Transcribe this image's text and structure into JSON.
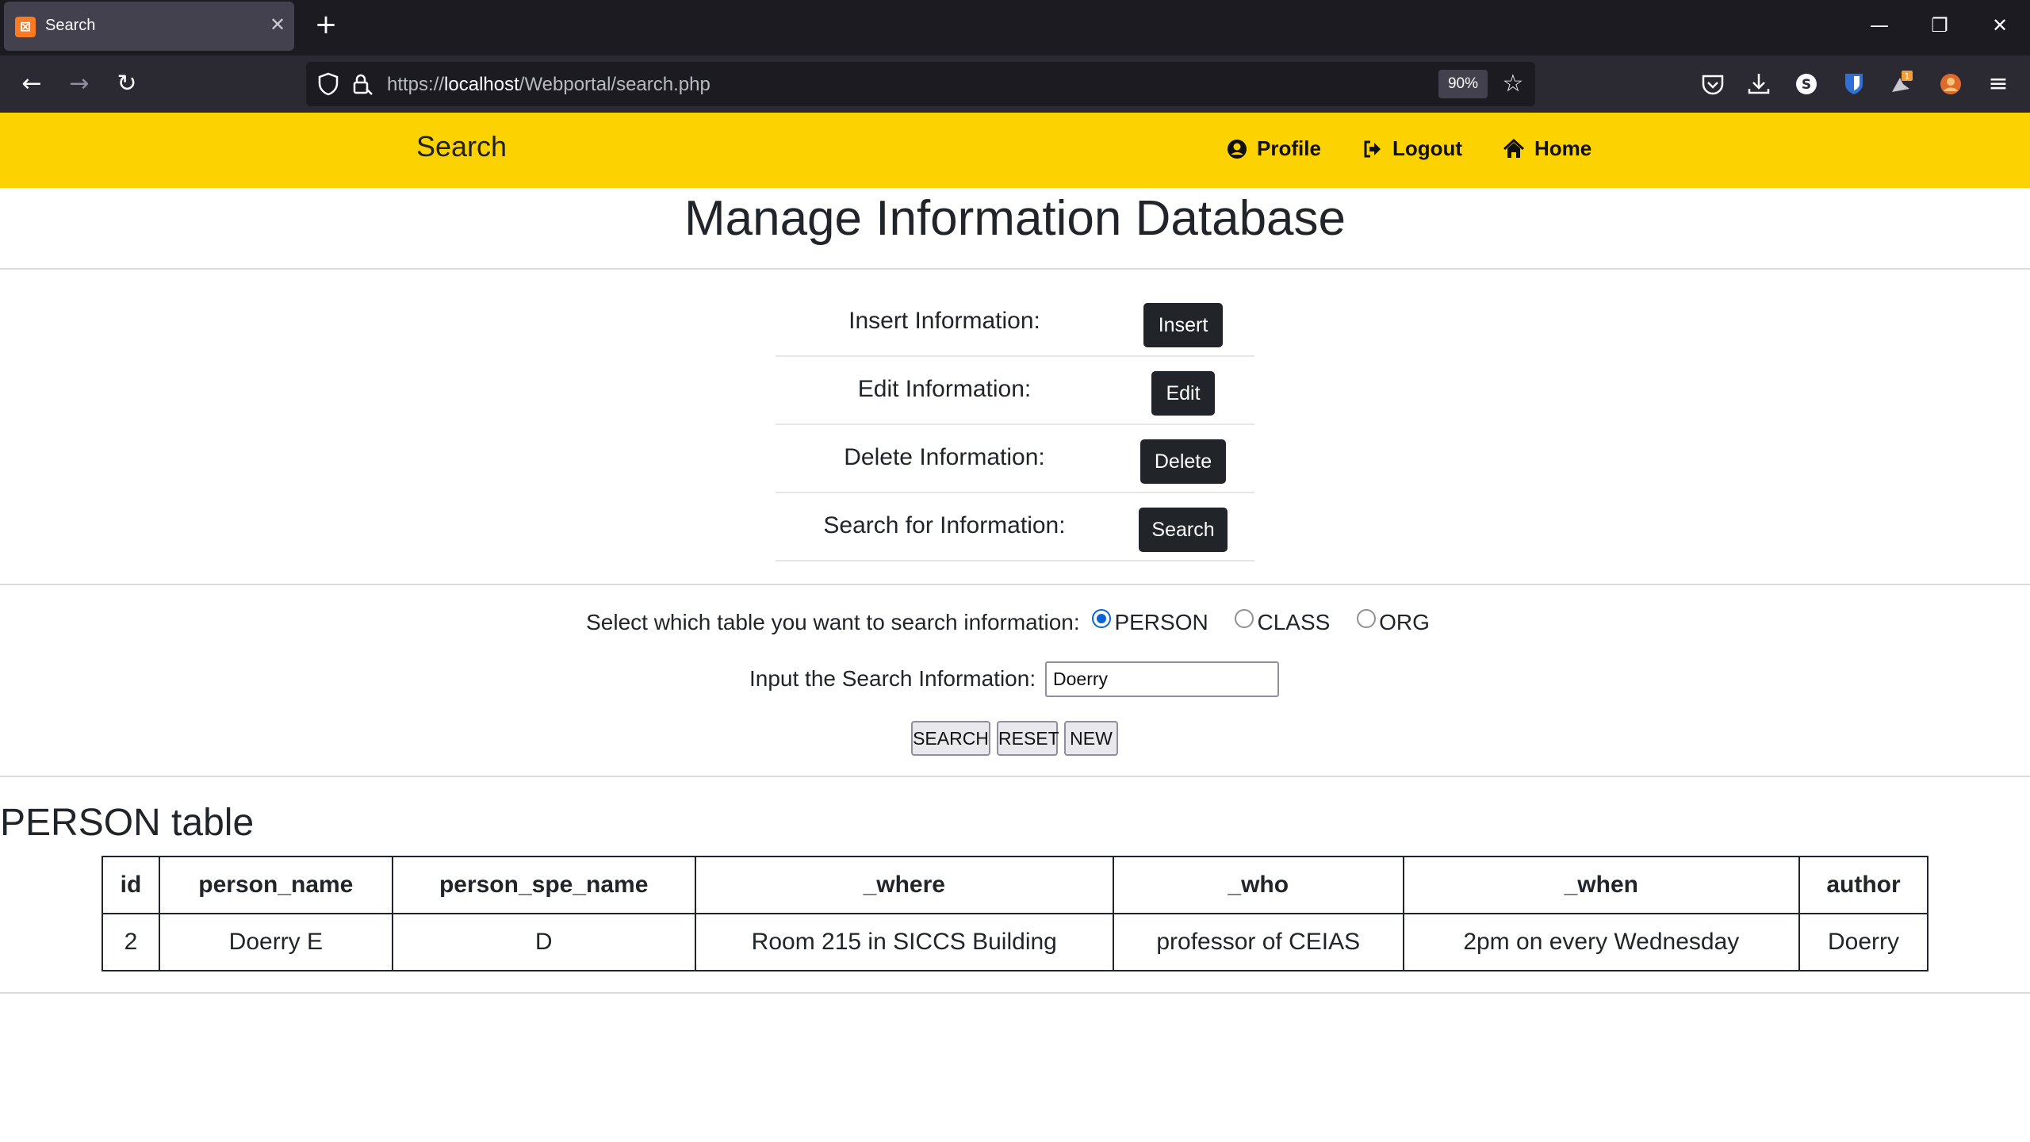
{
  "browser": {
    "tab_title": "Search",
    "tab_close": "✕",
    "new_tab": "+",
    "url_prefix": "https://",
    "url_host": "localhost",
    "url_path": "/Webportal/search.php",
    "zoom": "90%",
    "window_controls": {
      "minimize": "—",
      "restore": "❐",
      "close": "✕"
    }
  },
  "header": {
    "brand": "Search",
    "nav": [
      {
        "label": "Profile",
        "icon": "user-circle-icon"
      },
      {
        "label": "Logout",
        "icon": "sign-out-icon"
      },
      {
        "label": "Home",
        "icon": "home-icon"
      }
    ],
    "accent_color": "#fcd200"
  },
  "page_title": "Manage Information Database",
  "actions": [
    {
      "label": "Insert Information:",
      "button": "Insert"
    },
    {
      "label": "Edit Information:",
      "button": "Edit"
    },
    {
      "label": "Delete Information:",
      "button": "Delete"
    },
    {
      "label": "Search for Information:",
      "button": "Search"
    }
  ],
  "search_form": {
    "select_prompt": "Select which table you want to search information:",
    "options": [
      "PERSON",
      "CLASS",
      "ORG"
    ],
    "selected_option": "PERSON",
    "input_label": "Input the Search Information:",
    "input_value": "Doerry",
    "buttons": [
      "SEARCH",
      "RESET",
      "NEW"
    ]
  },
  "results": {
    "heading": "PERSON table",
    "columns": [
      "id",
      "person_name",
      "person_spe_name",
      "_where",
      "_who",
      "_when",
      "author"
    ],
    "rows": [
      [
        "2",
        "Doerry E",
        "D",
        "Room 215 in SICCS Building",
        "professor of CEIAS",
        "2pm on every Wednesday",
        "Doerry"
      ]
    ]
  }
}
